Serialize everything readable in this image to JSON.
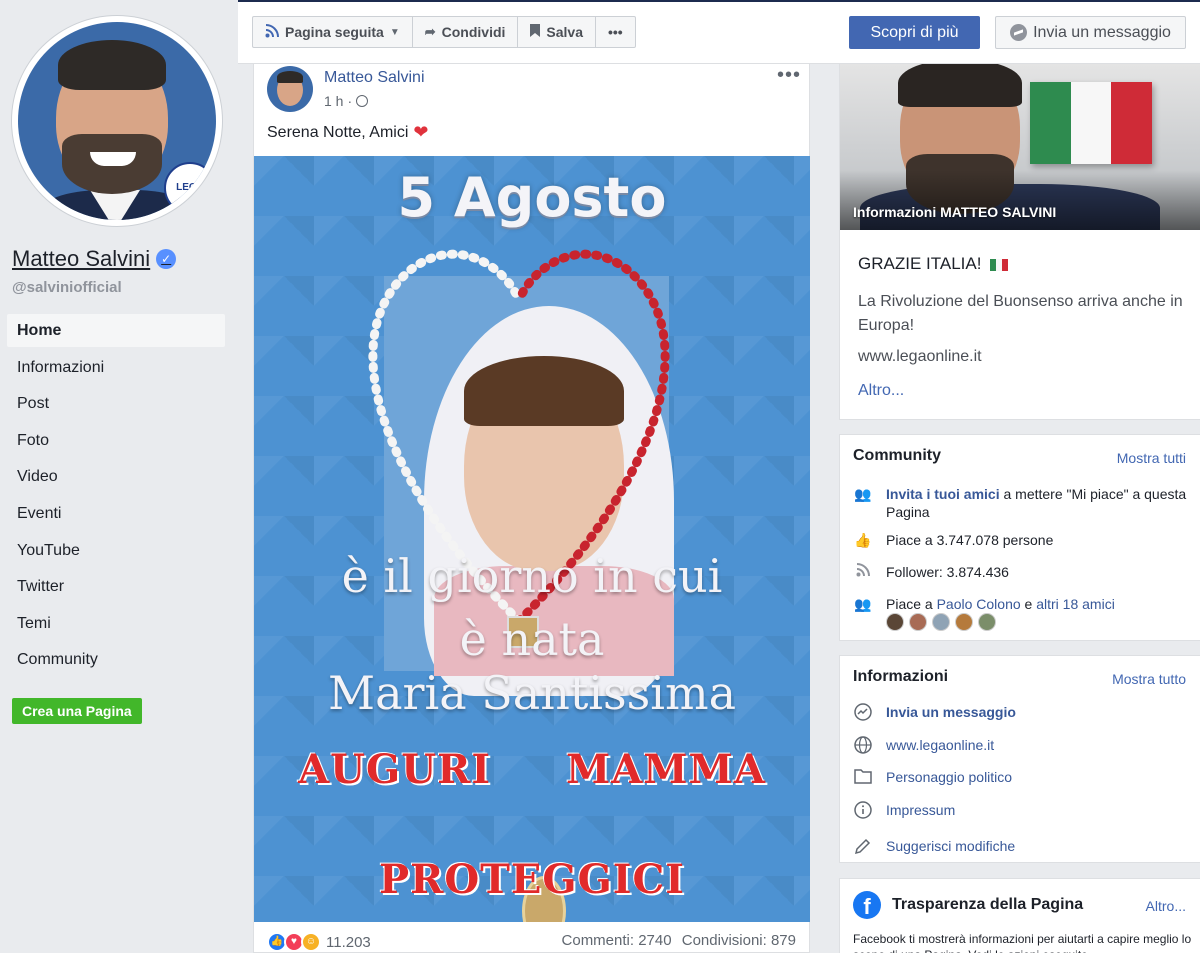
{
  "left": {
    "page_name": "Matteo Salvini",
    "handle": "@salviniofficial",
    "nav": [
      "Home",
      "Informazioni",
      "Post",
      "Foto",
      "Video",
      "Eventi",
      "YouTube",
      "Twitter",
      "Temi",
      "Community"
    ],
    "active_nav": "Home",
    "create_page": "Crea una Pagina",
    "badge_text": "LEGA"
  },
  "topbar": {
    "followed": "Pagina seguita",
    "share": "Condividi",
    "save": "Salva",
    "more": "•••",
    "cta": "Scopri di più",
    "message": "Invia un messaggio"
  },
  "post": {
    "author": "Matteo Salvini",
    "time": "1 h",
    "time_sep": "·",
    "text": "Serena Notte, Amici",
    "image_text": {
      "title": "5 Agosto",
      "line2": "è il giorno in cui",
      "line3": "è nata",
      "line4": "Maria Santissima",
      "auguri": "AUGURI MAMMA",
      "proteggici": "PROTEGGICI"
    },
    "reactions_count": "11.203",
    "comments": "Commenti: 2740",
    "shares": "Condivisioni: 879"
  },
  "about": {
    "cover_caption": "Informazioni MATTEO SALVINI",
    "heading": "GRAZIE ITALIA!",
    "description": "La Rivoluzione del Buonsenso arriva anche in Europa!",
    "url": "www.legaonline.it",
    "more": "Altro..."
  },
  "community": {
    "title": "Community",
    "see_all": "Mostra tutti",
    "invite_link": "Invita i tuoi amici",
    "invite_rest": " a mettere \"Mi piace\" a questa Pagina",
    "likes": "Piace a 3.747.078 persone",
    "followers": "Follower: 3.874.436",
    "friends_prefix": "Piace a ",
    "friend_name": "Paolo Colono",
    "friends_mid": " e ",
    "friends_others": "altri 18 amici"
  },
  "info": {
    "title": "Informazioni",
    "see_all": "Mostra tutto",
    "message": "Invia un messaggio",
    "website": "www.legaonline.it",
    "category": "Personaggio politico",
    "impressum": "Impressum",
    "suggest": "Suggerisci modifiche"
  },
  "transparency": {
    "title": "Trasparenza della Pagina",
    "more": "Altro...",
    "text": "Facebook ti mostrerà informazioni per aiutarti a capire meglio lo scopo di una Pagina. Vedi le azioni eseguite"
  },
  "colors": {
    "fb_blue": "#4267b2",
    "link": "#385898",
    "green_button": "#42b72a",
    "background": "#e9ebee"
  }
}
